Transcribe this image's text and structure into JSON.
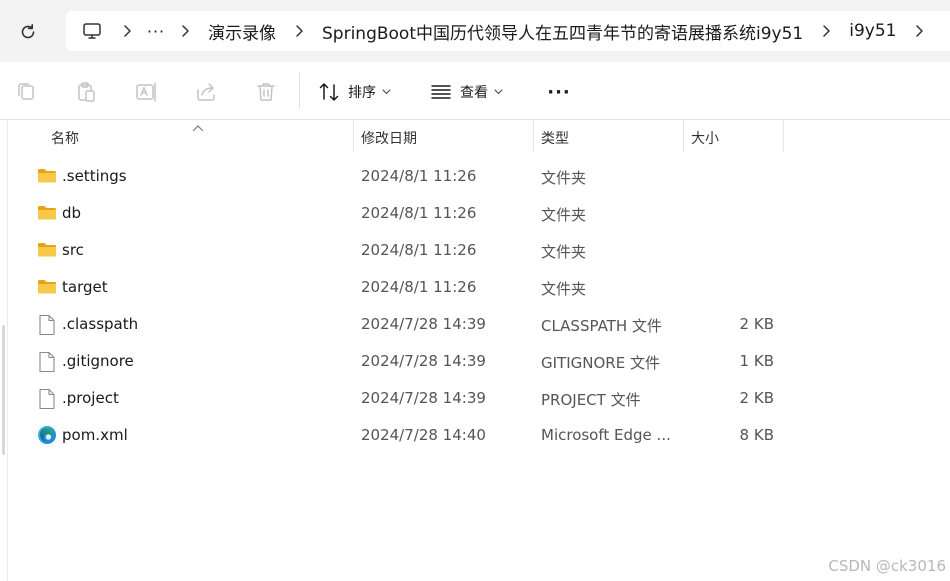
{
  "addressbar": {
    "more": "···",
    "crumbs": [
      "演示录像",
      "SpringBoot中国历代领导人在五四青年节的寄语展播系统i9y51",
      "i9y51"
    ]
  },
  "toolbar": {
    "sort_label": "排序",
    "view_label": "查看",
    "more_label": "···"
  },
  "columns": {
    "name": "名称",
    "date": "修改日期",
    "type": "类型",
    "size": "大小"
  },
  "files": [
    {
      "name": ".settings",
      "date": "2024/8/1 11:26",
      "type": "文件夹",
      "size": "",
      "icon": "folder-icon"
    },
    {
      "name": "db",
      "date": "2024/8/1 11:26",
      "type": "文件夹",
      "size": "",
      "icon": "folder-icon"
    },
    {
      "name": "src",
      "date": "2024/8/1 11:26",
      "type": "文件夹",
      "size": "",
      "icon": "folder-icon"
    },
    {
      "name": "target",
      "date": "2024/8/1 11:26",
      "type": "文件夹",
      "size": "",
      "icon": "folder-icon"
    },
    {
      "name": ".classpath",
      "date": "2024/7/28 14:39",
      "type": "CLASSPATH 文件",
      "size": "2 KB",
      "icon": "file-icon"
    },
    {
      "name": ".gitignore",
      "date": "2024/7/28 14:39",
      "type": "GITIGNORE 文件",
      "size": "1 KB",
      "icon": "file-icon"
    },
    {
      "name": ".project",
      "date": "2024/7/28 14:39",
      "type": "PROJECT 文件",
      "size": "2 KB",
      "icon": "file-icon"
    },
    {
      "name": "pom.xml",
      "date": "2024/7/28 14:40",
      "type": "Microsoft Edge ...",
      "size": "8 KB",
      "icon": "edge-icon"
    }
  ],
  "watermark": "CSDN @ck3016",
  "colors": {
    "folder": "#f7c948",
    "folder_dark": "#e8a317",
    "accent": "#0067c0"
  }
}
